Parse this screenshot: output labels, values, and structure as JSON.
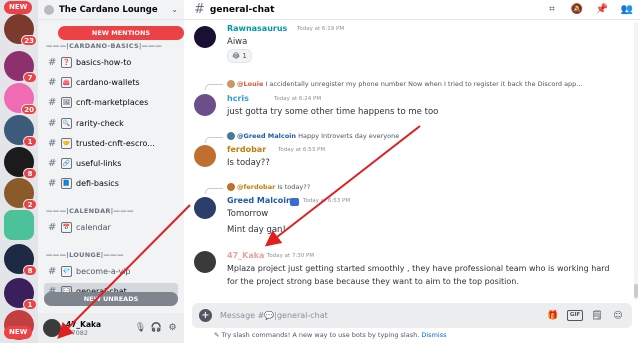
{
  "server": {
    "name": "The Cardano Lounge",
    "pills": {
      "top_new": "NEW",
      "bottom_new": "NEW"
    },
    "badges": [
      "23",
      "7",
      "20",
      "1",
      "8",
      "2",
      "8",
      "1"
    ]
  },
  "sidebar": {
    "new_mentions": "NEW MENTIONS",
    "new_unreads": "NEW UNREADS",
    "categories": {
      "cardano_basics": "———|CARDANO-BASICS|———",
      "calendar": "———|CALENDAR|———",
      "lounge": "———|LOUNGE|———"
    },
    "channels": [
      {
        "label": "basics-how-to",
        "emoji": "❓"
      },
      {
        "label": "cardano-wallets",
        "emoji": "👛"
      },
      {
        "label": "cnft-marketplaces",
        "emoji": "🖼"
      },
      {
        "label": "rarity-check",
        "emoji": "🔍"
      },
      {
        "label": "trusted-cnft-escro...",
        "emoji": "🤝"
      },
      {
        "label": "useful-links",
        "emoji": "🔗"
      },
      {
        "label": "defi-basics",
        "emoji": "📘"
      },
      {
        "label": "calendar",
        "emoji": "📅"
      },
      {
        "label": "become-a-vip",
        "emoji": "💎"
      },
      {
        "label": "general-chat",
        "emoji": "💬"
      }
    ],
    "user": {
      "name": "47_Kaka",
      "tag": "#7082"
    }
  },
  "channel": {
    "name": "general-chat"
  },
  "messages": [
    {
      "author": "Rawnasaurus",
      "author_color": "#0097a7",
      "time": "Today at 6:19 PM",
      "text": "Aiwa",
      "reaction": "😂 1"
    },
    {
      "reply_author": "@Louie",
      "reply_text": "I accidentally unregister my phone number  Now when I tried to register it back the Discord app...",
      "author": "hcris",
      "author_color": "#2e9fd6",
      "time": "Today at 6:24 PM",
      "text": "just gotta try some other time happens to me too"
    },
    {
      "reply_author": "@Greed Malcoin",
      "reply_text": "Happy Introverts day everyone",
      "author": "ferdobar",
      "author_color": "#c27c0e",
      "time": "Today at 6:53 PM",
      "text": "Is today??"
    },
    {
      "reply_author": "@ferdobar",
      "reply_text": "Is today??",
      "author": "Greed Malcoin",
      "author_color": "#1f5aa8",
      "time": "Today at 6:53 PM",
      "text": "Tomorrow",
      "text2": "Mint day gan!"
    },
    {
      "author": "47_Kaka",
      "author_color": "#e6a3a3",
      "time": "Today at 7:30 PM",
      "text": "Mplaza project just getting started smoothly , they have professional team who is working hard",
      "text2": "for the project strong base because they want to aim to the top position."
    }
  ],
  "composer": {
    "placeholder": "Message #💬|general-chat",
    "tip": "Try slash commands! A new way to use bots by typing slash.",
    "dismiss": "Dismiss",
    "gif": "GIF"
  },
  "colors": {
    "accent_red": "#ed4245",
    "link_blue": "#0068e0",
    "annotation_arrow": "#e02020"
  }
}
